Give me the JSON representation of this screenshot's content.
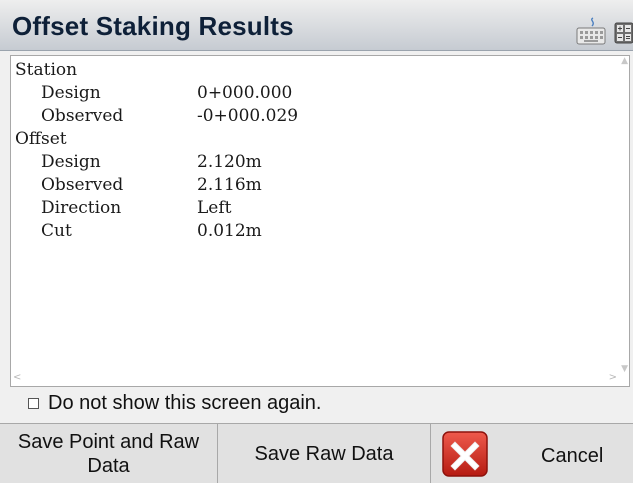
{
  "window": {
    "title": "Offset Staking Results"
  },
  "results": {
    "station_heading": "Station",
    "station_rows": [
      {
        "label": "Design",
        "value": "0+000.000"
      },
      {
        "label": "Observed",
        "value": "-0+000.029"
      }
    ],
    "offset_heading": "Offset",
    "offset_rows": [
      {
        "label": "Design",
        "value": "2.120m"
      },
      {
        "label": "Observed",
        "value": "2.116m"
      },
      {
        "label": "Direction",
        "value": "Left"
      },
      {
        "label": "Cut",
        "value": "0.012m"
      }
    ]
  },
  "checkbox": {
    "label": "Do not show this screen again.",
    "checked": false
  },
  "buttons": {
    "save_point_raw": "Save Point and Raw Data",
    "save_raw": "Save Raw Data",
    "cancel": "Cancel"
  },
  "icons": {
    "keyboard": "keyboard-icon",
    "calculator": "calculator-icon",
    "cancel": "red-x-icon"
  },
  "colors": {
    "cancel_red": "#d0261d",
    "title_text": "#0e2038"
  }
}
